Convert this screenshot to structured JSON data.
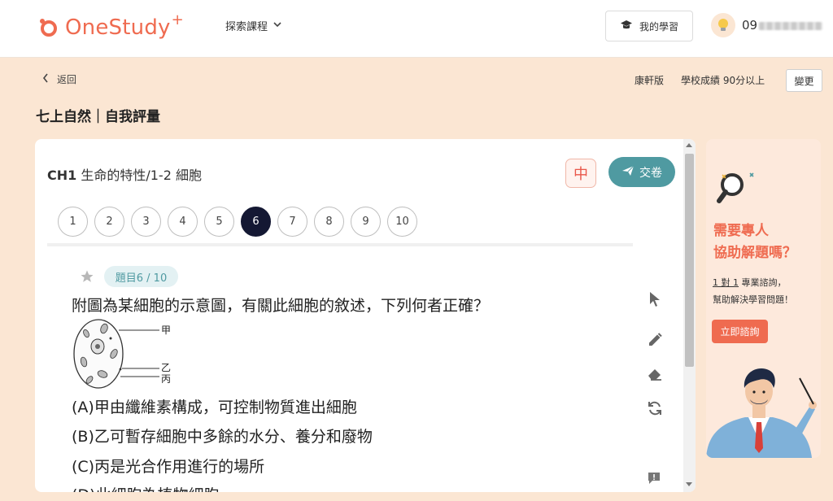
{
  "header": {
    "logo_text": "OneStudy",
    "logo_plus": "+",
    "explore_label": "探索課程",
    "my_learning_label": "我的學習",
    "user_phone_visible": "09"
  },
  "subbar": {
    "back_label": "返回",
    "edition": "康軒版",
    "score_level": "學校成績 90分以上",
    "change_label": "變更"
  },
  "page": {
    "title": "七上自然｜自我評量"
  },
  "quiz": {
    "chapter_code": "CH1",
    "chapter_name": " 生命的特性/1-2 細胞",
    "difficulty": "中",
    "submit_label": "交卷",
    "question_numbers": [
      "1",
      "2",
      "3",
      "4",
      "5",
      "6",
      "7",
      "8",
      "9",
      "10"
    ],
    "current_question": "6",
    "question_badge": "題目6 / 10",
    "question_text": "附圖為某細胞的示意圖，有關此細胞的敘述，下列何者正確？",
    "figure_labels": {
      "a": "甲",
      "b": "乙",
      "c": "丙"
    },
    "options": [
      "(A)甲由纖維素構成，可控制物質進出細胞",
      "(B)乙可暫存細胞中多餘的水分、養分和廢物",
      "(C)丙是光合作用進行的場所",
      "(D)此細胞為植物細胞"
    ]
  },
  "tools": [
    "cursor-icon",
    "pencil-icon",
    "eraser-icon",
    "refresh-icon",
    "report-icon"
  ],
  "ad": {
    "title_line1": "需要專人",
    "title_line2": "協助解題嗎？",
    "text_line1_a": "1 對 1",
    "text_line1_b": " 專業諮詢，",
    "text_line2": "幫助解決學習問題！",
    "button_label": "立即諮詢"
  },
  "colors": {
    "brand": "#ef6b50",
    "teal": "#4f9aa1",
    "page_bg": "#fbe6d3",
    "active_number": "#141833"
  }
}
